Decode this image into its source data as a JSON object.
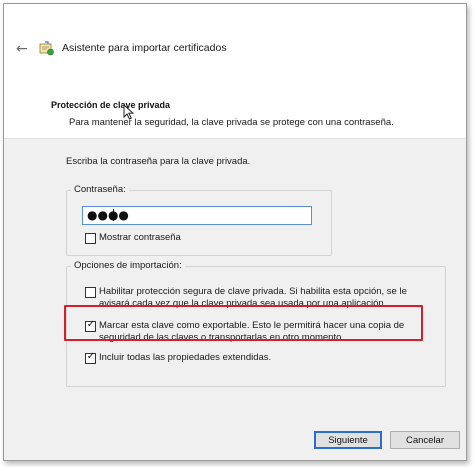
{
  "window": {
    "title": "Asistente para importar certificados",
    "back_icon": "back-arrow-icon",
    "app_icon": "certificate-wizard-icon"
  },
  "header": {
    "section_title": "Protección de clave privada",
    "section_desc": "Para mantener la seguridad, la clave privada se protege con una contraseña."
  },
  "body": {
    "instruction": "Escriba la contraseña para la clave privada.",
    "password_group": {
      "legend": "Contraseña:",
      "value_masked": "●●●●",
      "show_password": {
        "label": "Mostrar contraseña",
        "checked": false
      }
    },
    "options_group": {
      "legend": "Opciones de importación:",
      "options": [
        {
          "line1": "Habilitar protección segura de clave privada. Si habilita esta opción, se le",
          "line2": "avisará cada vez que la clave privada sea usada por una aplicación.",
          "checked": false
        },
        {
          "line1": "Marcar esta clave como exportable. Esto le permitirá hacer una copia de",
          "line2": "seguridad de las claves o transportarlas en otro momento.",
          "checked": true,
          "highlight_color": "#d4202a"
        },
        {
          "line1": "Incluir todas las propiedades extendidas.",
          "checked": true
        }
      ]
    }
  },
  "footer": {
    "next_label": "Siguiente",
    "cancel_label": "Cancelar",
    "accent_color": "#2b6fc9"
  }
}
